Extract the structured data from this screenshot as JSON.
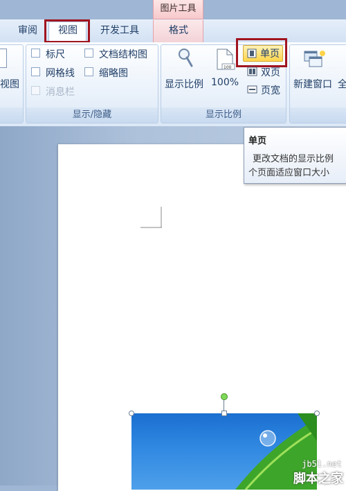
{
  "context_tab": "图片工具",
  "tabs": [
    {
      "label": "审阅"
    },
    {
      "label": "视图",
      "active": true
    },
    {
      "label": "开发工具"
    },
    {
      "label": "格式"
    }
  ],
  "ribbon": {
    "view_mode_partial_label": "视图",
    "show_hide_group": {
      "label": "显示/隐藏",
      "items": [
        {
          "label": "标尺",
          "checked": false,
          "enabled": true
        },
        {
          "label": "文档结构图",
          "checked": false,
          "enabled": true
        },
        {
          "label": "网格线",
          "checked": false,
          "enabled": true
        },
        {
          "label": "缩略图",
          "checked": false,
          "enabled": true
        },
        {
          "label": "消息栏",
          "checked": false,
          "enabled": false
        }
      ]
    },
    "zoom_group": {
      "label": "显示比例",
      "zoom_button": "显示比例",
      "percent_button": "100%",
      "single_page": "单页",
      "two_pages": "双页",
      "page_width": "页宽"
    },
    "window_group": {
      "new_window": "新建窗口",
      "partial_next": "全"
    }
  },
  "tooltip": {
    "title": "单页",
    "line1": "更改文档的显示比例",
    "line2": "个页面适应窗口大小"
  },
  "watermark": {
    "site": "jb51.net",
    "name": "脚本之家"
  },
  "colors": {
    "highlight": "#a0141f",
    "active_button": "#ffd44a"
  }
}
